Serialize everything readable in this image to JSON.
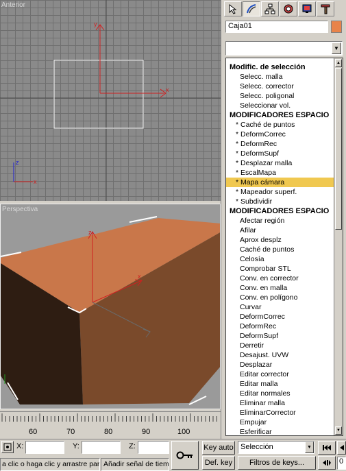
{
  "viewports": {
    "top_label": "Anterior",
    "perspective_label": "Perspectiva",
    "axis_x": "x",
    "axis_y": "y",
    "axis_z": "z"
  },
  "command_panel": {
    "tabs": [
      {
        "name": "create-icon"
      },
      {
        "name": "modify-icon"
      },
      {
        "name": "hierarchy-icon"
      },
      {
        "name": "motion-icon"
      },
      {
        "name": "display-icon"
      },
      {
        "name": "utilities-icon"
      }
    ],
    "object_name": "Caja01",
    "object_color": "#e8834a",
    "modifier_dropdown_value": "",
    "modifier_list": [
      {
        "label": "Modific. de selección",
        "kind": "header"
      },
      {
        "label": "Selecc. malla",
        "kind": "item"
      },
      {
        "label": "Selecc. corrector",
        "kind": "item"
      },
      {
        "label": "Selecc. poligonal",
        "kind": "item"
      },
      {
        "label": "Seleccionar vol.",
        "kind": "item"
      },
      {
        "label": "MODIFICADORES ESPACIO",
        "kind": "header"
      },
      {
        "label": "* Caché de puntos",
        "kind": "sub"
      },
      {
        "label": "* DeformCorrec",
        "kind": "sub"
      },
      {
        "label": "* DeformRec",
        "kind": "sub"
      },
      {
        "label": "* DeformSupf",
        "kind": "sub"
      },
      {
        "label": "* Desplazar malla",
        "kind": "sub"
      },
      {
        "label": "* EscalMapa",
        "kind": "sub"
      },
      {
        "label": "* Mapa cámara",
        "kind": "sub",
        "selected": true
      },
      {
        "label": "* Mapeador superf.",
        "kind": "sub"
      },
      {
        "label": "* Subdividir",
        "kind": "sub"
      },
      {
        "label": "MODIFICADORES ESPACIO",
        "kind": "header"
      },
      {
        "label": "Afectar región",
        "kind": "item"
      },
      {
        "label": "Afilar",
        "kind": "item"
      },
      {
        "label": "Aprox desplz",
        "kind": "item"
      },
      {
        "label": "Caché de puntos",
        "kind": "item"
      },
      {
        "label": "Celosía",
        "kind": "item"
      },
      {
        "label": "Comprobar STL",
        "kind": "item"
      },
      {
        "label": "Conv. en corrector",
        "kind": "item"
      },
      {
        "label": "Conv. en malla",
        "kind": "item"
      },
      {
        "label": "Conv. en polígono",
        "kind": "item"
      },
      {
        "label": "Curvar",
        "kind": "item"
      },
      {
        "label": "DeformCorrec",
        "kind": "item"
      },
      {
        "label": "DeformRec",
        "kind": "item"
      },
      {
        "label": "DeformSupf",
        "kind": "item"
      },
      {
        "label": "Derretir",
        "kind": "item"
      },
      {
        "label": "Desajust. UVW",
        "kind": "item"
      },
      {
        "label": "Desplazar",
        "kind": "item"
      },
      {
        "label": "Editar corrector",
        "kind": "item"
      },
      {
        "label": "Editar malla",
        "kind": "item"
      },
      {
        "label": "Editar normales",
        "kind": "item"
      },
      {
        "label": "Eliminar malla",
        "kind": "item"
      },
      {
        "label": "EliminarCorrector",
        "kind": "item"
      },
      {
        "label": "Empujar",
        "kind": "item"
      },
      {
        "label": "Esferificar",
        "kind": "item"
      }
    ]
  },
  "timeline": {
    "ticks": [
      "60",
      "70",
      "80",
      "90",
      "100"
    ]
  },
  "status_bar": {
    "x_label": "X:",
    "y_label": "Y:",
    "z_label": "Z:",
    "x_value": "",
    "y_value": "",
    "z_value": "",
    "key_auto": "Key auto",
    "def_key": "Def. key",
    "selection_value": "Selección",
    "filters_button": "Filtros de keys...",
    "prompt_text": "a clic o haga clic y arrastre par",
    "add_time_tag": "Añadir señal de tiem",
    "frame_field": "0"
  }
}
